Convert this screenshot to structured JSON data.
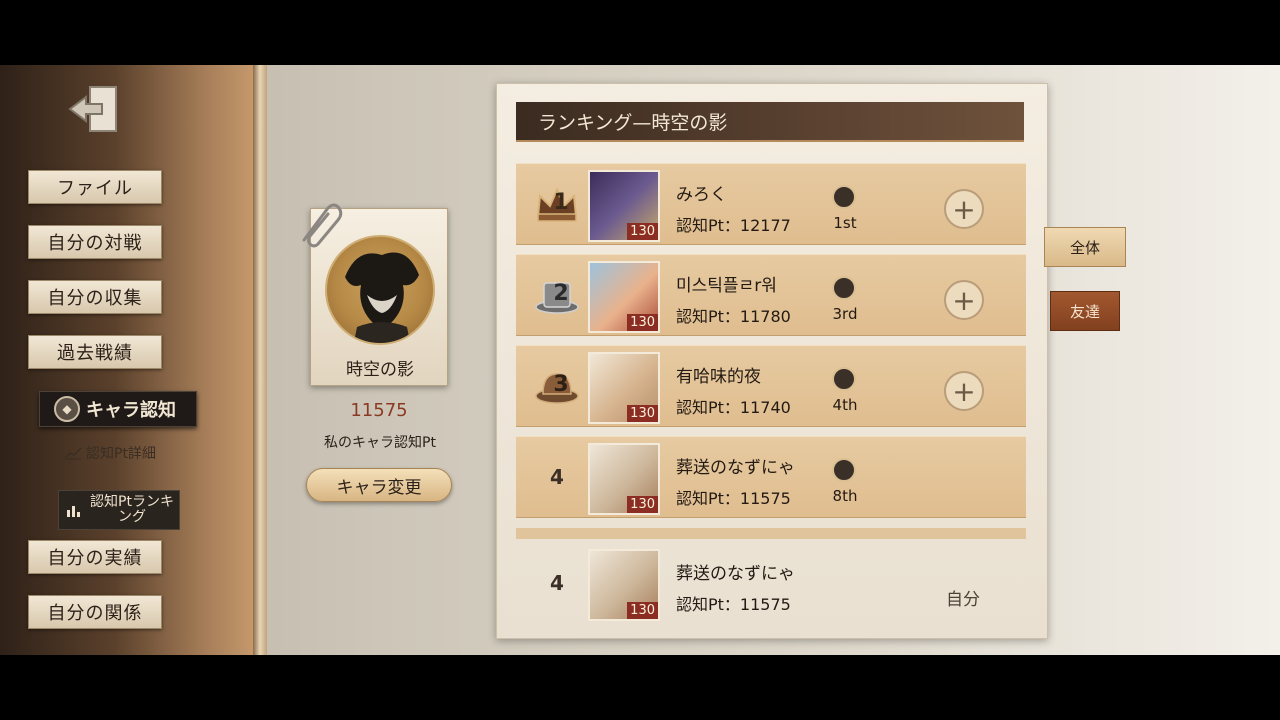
{
  "menu": {
    "file": "ファイル",
    "battles": "自分の対戦",
    "collection": "自分の収集",
    "past_results": "過去戦績",
    "char_recognition": "キャラ認知",
    "pt_detail": "認知Pt詳細",
    "pt_ranking": "認知Ptランキング",
    "achievements": "自分の実績",
    "relations": "自分の関係"
  },
  "character": {
    "name": "時空の影",
    "points": "11575",
    "points_label": "私のキャラ認知Pt",
    "change_button": "キャラ変更"
  },
  "ranking": {
    "title": "ランキング—時空の影",
    "rows": [
      {
        "rank": "1",
        "name": "みろく",
        "pt": "認知Pt：12177",
        "place": "1st",
        "level": "130"
      },
      {
        "rank": "2",
        "name": "미스틱플ㄹr워",
        "pt": "認知Pt：11780",
        "place": "3rd",
        "level": "130"
      },
      {
        "rank": "3",
        "name": "有哈味的夜",
        "pt": "認知Pt：11740",
        "place": "4th",
        "level": "130"
      },
      {
        "rank": "4",
        "name": "葬送のなずにゃ",
        "pt": "認知Pt：11575",
        "place": "8th",
        "level": "130"
      }
    ],
    "self": {
      "rank": "4",
      "name": "葬送のなずにゃ",
      "pt": "認知Pt：11575",
      "level": "130",
      "label": "自分"
    }
  },
  "tabs": {
    "all": "全体",
    "friends": "友達"
  },
  "colors": {
    "accent": "#8a3a22",
    "row_bg": "#e2c396",
    "header_bg": "#4a3628"
  }
}
